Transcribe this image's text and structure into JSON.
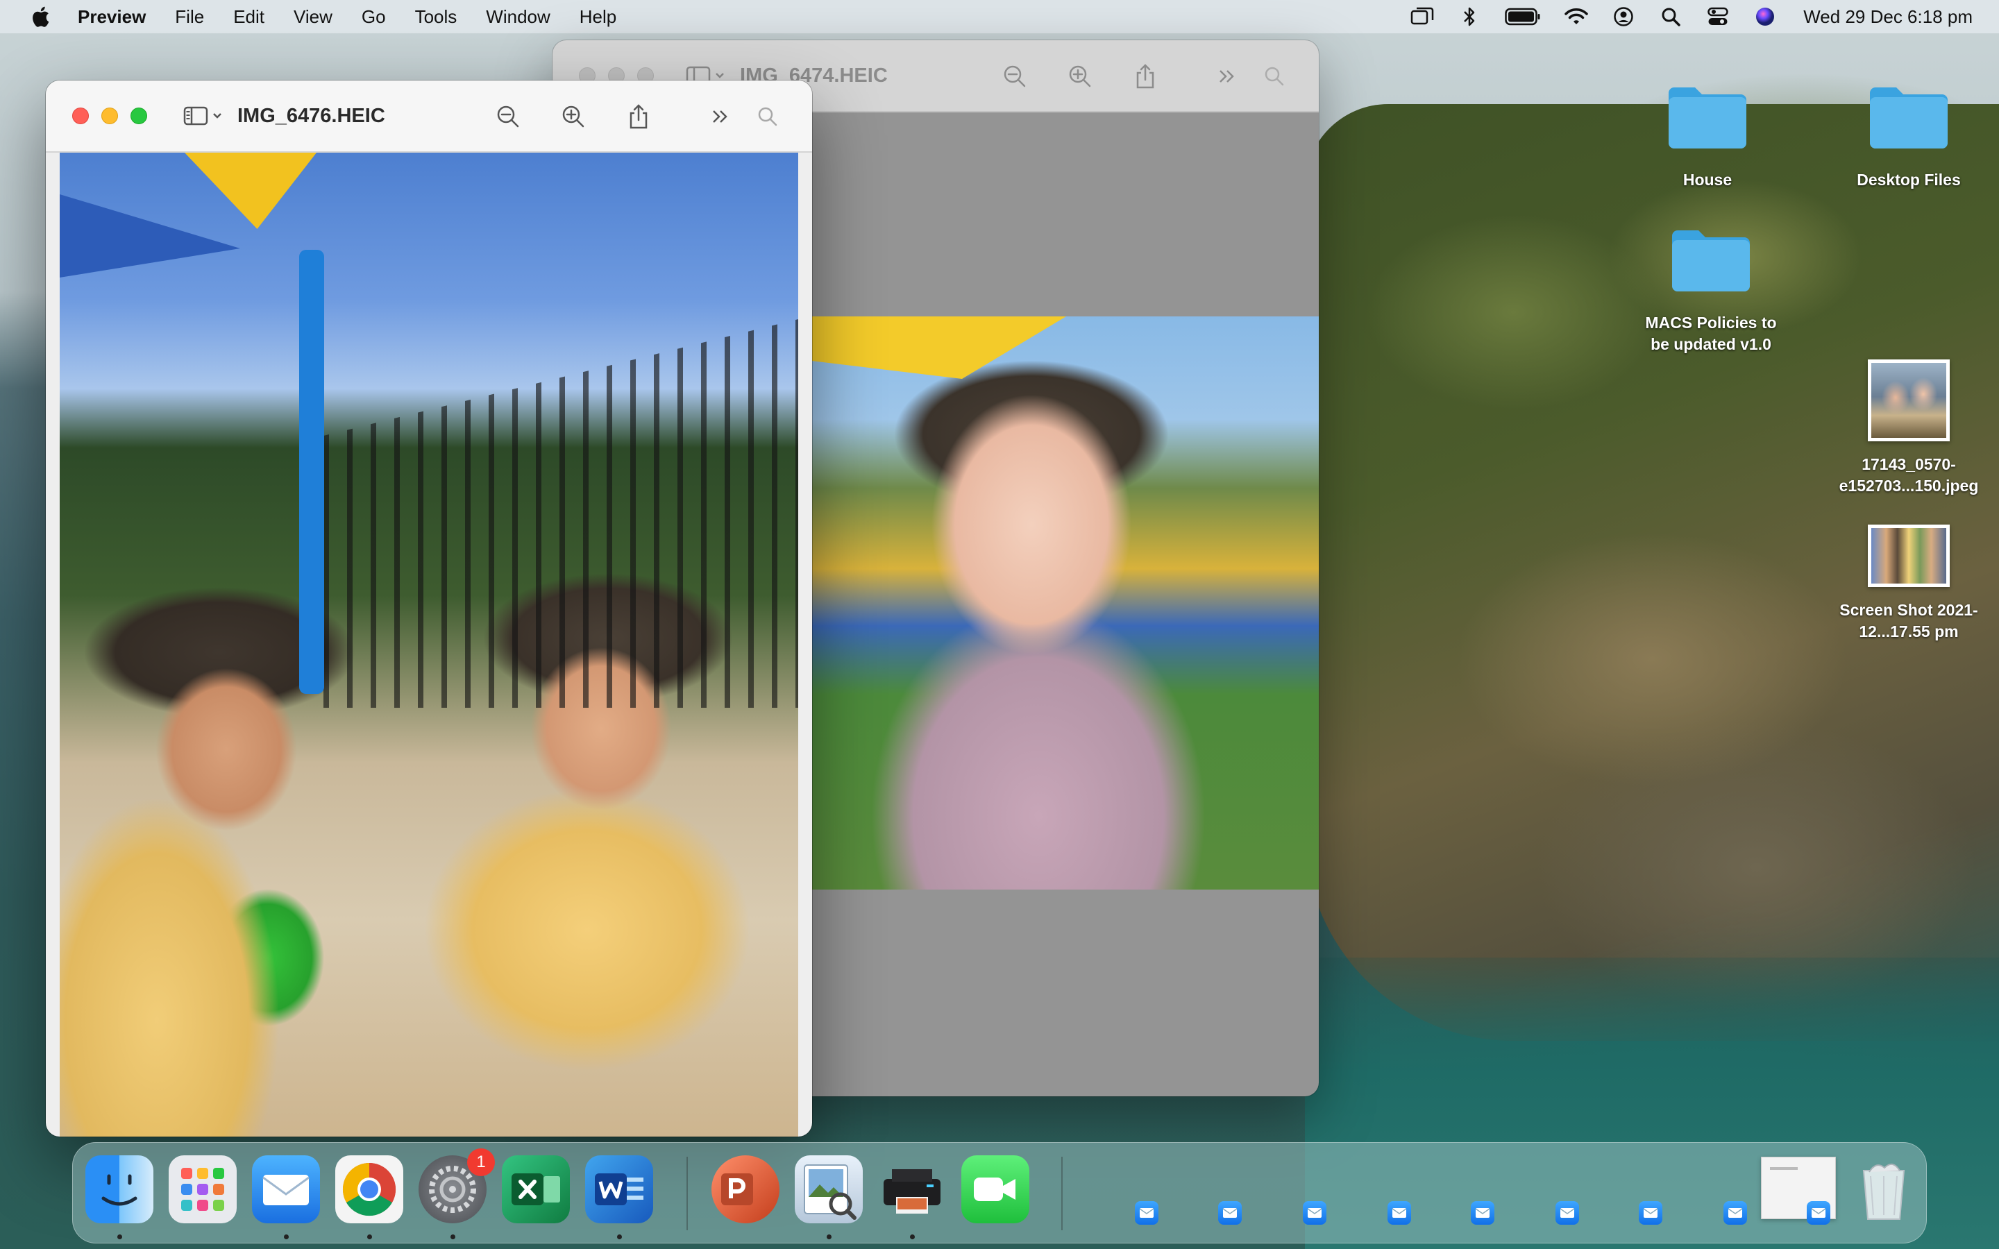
{
  "menubar": {
    "app_name": "Preview",
    "menus": [
      "File",
      "Edit",
      "View",
      "Go",
      "Tools",
      "Window",
      "Help"
    ],
    "status_icons": [
      "screen-mirroring-icon",
      "bluetooth-icon",
      "battery-icon",
      "wifi-icon",
      "user-icon",
      "spotlight-icon",
      "control-center-icon",
      "siri-icon"
    ],
    "clock": "Wed 29 Dec  6:18 pm"
  },
  "windows": {
    "back": {
      "title": "IMG_6474.HEIC"
    },
    "front": {
      "title": "IMG_6476.HEIC"
    }
  },
  "desktop": {
    "items": [
      {
        "label": "House",
        "kind": "folder"
      },
      {
        "label": "Desktop Files",
        "kind": "folder"
      },
      {
        "label": "MACS Policies to be updated v1.0",
        "kind": "folder"
      },
      {
        "label": "17143_0570-e152703...150.jpeg",
        "kind": "image"
      },
      {
        "label": "Screen Shot 2021-12...17.55 pm",
        "kind": "image"
      }
    ]
  },
  "dock": {
    "apps": [
      "Finder",
      "Launchpad",
      "Mail",
      "Google Chrome",
      "System Preferences",
      "Microsoft Excel",
      "Microsoft Word",
      "Microsoft PowerPoint",
      "Preview",
      "Printer",
      "FaceTime"
    ],
    "system_preferences_badge": "1",
    "trash": "Trash"
  },
  "colors": {
    "folder_blue": "#5ab8ec",
    "close": "#ff5f57",
    "minimize": "#febc2e",
    "zoom": "#28c840"
  }
}
